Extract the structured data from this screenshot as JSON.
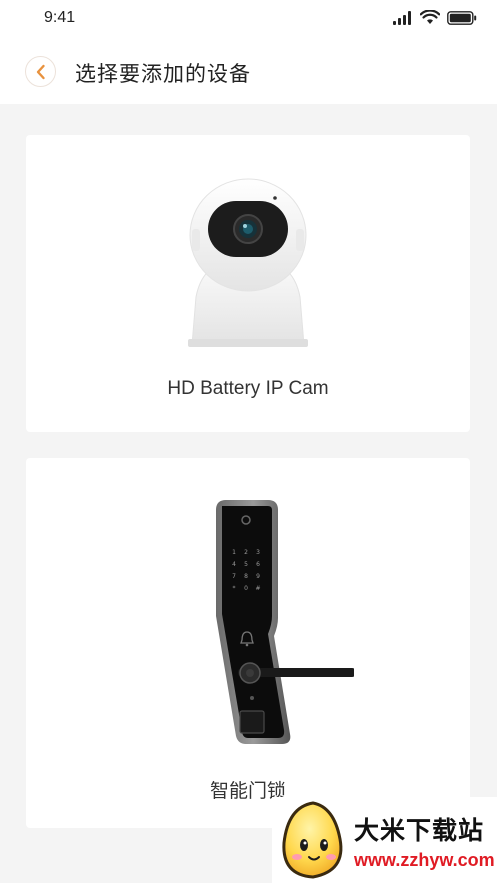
{
  "status_bar": {
    "time": "9:41"
  },
  "header": {
    "back_icon": "chevron-left-icon",
    "title": "选择要添加的设备"
  },
  "devices": [
    {
      "name": "HD Battery IP Cam",
      "image": "ip-camera-image"
    },
    {
      "name": "智能门锁",
      "image": "smart-door-lock-image"
    }
  ],
  "keypad_keys": [
    "1",
    "2",
    "3",
    "4",
    "5",
    "6",
    "7",
    "8",
    "9",
    "*",
    "0",
    "#"
  ],
  "watermark": {
    "name": "大米下载站",
    "url": "www.zzhyw.com"
  },
  "colors": {
    "accent": "#e8923e",
    "background": "#f4f4f4",
    "card": "#ffffff",
    "watermark_url": "#e01b24"
  }
}
